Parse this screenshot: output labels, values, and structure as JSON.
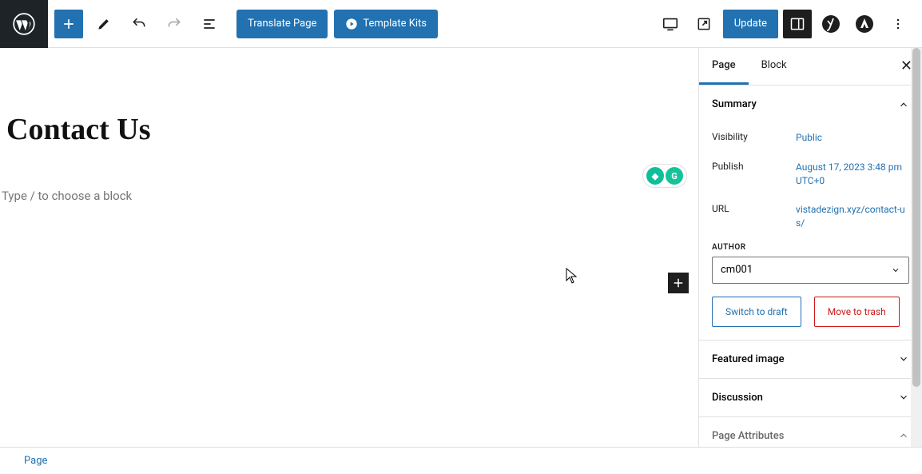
{
  "toolbar": {
    "translate_label": "Translate Page",
    "template_kits_label": "Template Kits",
    "update_label": "Update"
  },
  "editor": {
    "page_title": "Contact Us",
    "block_placeholder": "Type / to choose a block"
  },
  "sidebar": {
    "tabs": {
      "page": "Page",
      "block": "Block"
    },
    "panels": {
      "summary": {
        "title": "Summary",
        "visibility_label": "Visibility",
        "visibility_value": "Public",
        "publish_label": "Publish",
        "publish_value": "August 17, 2023 3:48 pm UTC+0",
        "url_label": "URL",
        "url_value": "vistadezign.xyz/contact-us/",
        "author_label": "AUTHOR",
        "author_value": "cm001",
        "switch_draft": "Switch to draft",
        "move_trash": "Move to trash"
      },
      "featured_image": "Featured image",
      "discussion": "Discussion",
      "page_attributes": "Page Attributes"
    }
  },
  "footer": {
    "breadcrumb": "Page"
  }
}
